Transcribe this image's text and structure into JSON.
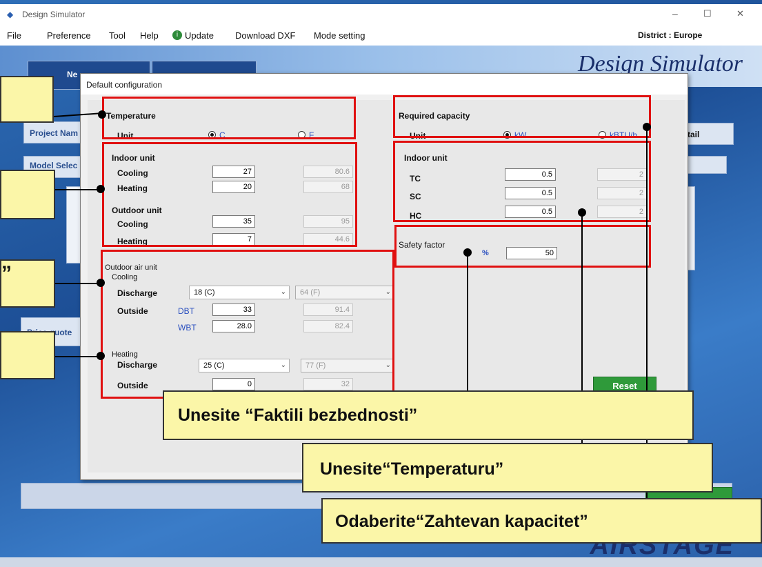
{
  "window": {
    "title": "Design Simulator",
    "minimize": "–",
    "maximize": "☐",
    "close": "✕"
  },
  "menu": {
    "file": "File",
    "preference": "Preference",
    "tool": "Tool",
    "help": "Help",
    "update": "Update",
    "download_dxf": "Download DXF",
    "mode_setting": "Mode setting",
    "district": "District : Europe"
  },
  "brand": {
    "title": "Design Simulator",
    "bottom": "AIRSTAGE"
  },
  "background": {
    "new_label": "Ne",
    "project_name": "Project Nam",
    "model_select": "Model Selec",
    "price_quote": "Price quote",
    "detail": "tail"
  },
  "dialog": {
    "title": "Default configuration",
    "temperature": {
      "heading": "Temperature",
      "unit_label": "Unit",
      "opt_c": "C",
      "opt_f": "F"
    },
    "indoor": {
      "heading": "Indoor unit",
      "cooling": "Cooling",
      "heating": "Heating",
      "cooling_c": "27",
      "cooling_f": "80.6",
      "heating_c": "20",
      "heating_f": "68"
    },
    "outdoor": {
      "heading": "Outdoor unit",
      "cooling": "Cooling",
      "heating": "Heating",
      "cooling_c": "35",
      "cooling_f": "95",
      "heating_c": "7",
      "heating_f": "44.6"
    },
    "oau": {
      "heading": "Outdoor air unit",
      "cooling": "Cooling",
      "discharge": "Discharge",
      "outside": "Outside",
      "dbt": "DBT",
      "wbt": "WBT",
      "cool_discharge_c": "18 (C)",
      "cool_discharge_f": "64 (F)",
      "dbt_c": "33",
      "dbt_f": "91.4",
      "wbt_c": "28.0",
      "wbt_f": "82.4",
      "heating": "Heating",
      "heat_discharge_c": "25 (C)",
      "heat_discharge_f": "77 (F)",
      "heat_outside_c": "0",
      "heat_outside_f": "32"
    },
    "capacity": {
      "heading": "Required capacity",
      "unit_label": "Unit",
      "opt_kw": "kW",
      "opt_btu": "kBTU/h"
    },
    "cap_indoor": {
      "heading": "Indoor unit",
      "tc": "TC",
      "sc": "SC",
      "hc": "HC",
      "tc_val": "0.5",
      "sc_val": "0.5",
      "hc_val": "0.5",
      "tc_ro": "2",
      "sc_ro": "2",
      "hc_ro": "2"
    },
    "safety": {
      "label": "Safety factor",
      "unit": "%",
      "value": "50"
    },
    "reset": "Reset"
  },
  "callouts": {
    "safety_factor": "Unesite “Faktili bezbednosti”",
    "temperature": "Unesite“Temperaturu”",
    "capacity": "Odaberite“Zahtevan kapacitet”",
    "left_quote": "”"
  },
  "colors": {
    "highlight_red": "#e01010",
    "callout_yellow": "#fbf6a8",
    "reset_green": "#2f9a3a"
  }
}
